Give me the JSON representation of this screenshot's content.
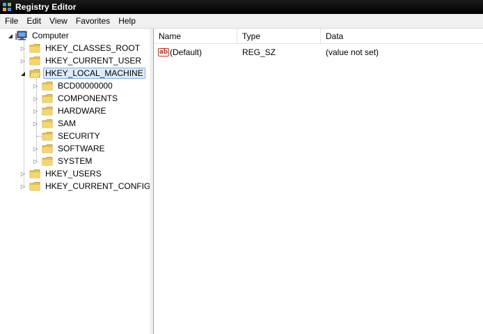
{
  "window": {
    "title": "Registry Editor"
  },
  "menu": [
    "File",
    "Edit",
    "View",
    "Favorites",
    "Help"
  ],
  "tree": {
    "root": "Computer",
    "hives": [
      "HKEY_CLASSES_ROOT",
      "HKEY_CURRENT_USER",
      "HKEY_LOCAL_MACHINE",
      "HKEY_USERS",
      "HKEY_CURRENT_CONFIG"
    ],
    "selected": "HKEY_LOCAL_MACHINE",
    "local_machine_children": [
      "BCD00000000",
      "COMPONENTS",
      "HARDWARE",
      "SAM",
      "SECURITY",
      "SOFTWARE",
      "SYSTEM"
    ]
  },
  "list": {
    "columns": [
      "Name",
      "Type",
      "Data"
    ],
    "rows": [
      {
        "name": "(Default)",
        "type": "REG_SZ",
        "data": "(value not set)"
      }
    ]
  },
  "icons": {
    "app": "registry-editor-icon",
    "computer": "computer-icon",
    "folder": "folder-icon",
    "string_value": "string-value-icon"
  },
  "colors": {
    "titlebar": "#000000",
    "folder": "#e8c04a",
    "selection_bg": "#dcebfc",
    "selection_border": "#84acdd"
  }
}
